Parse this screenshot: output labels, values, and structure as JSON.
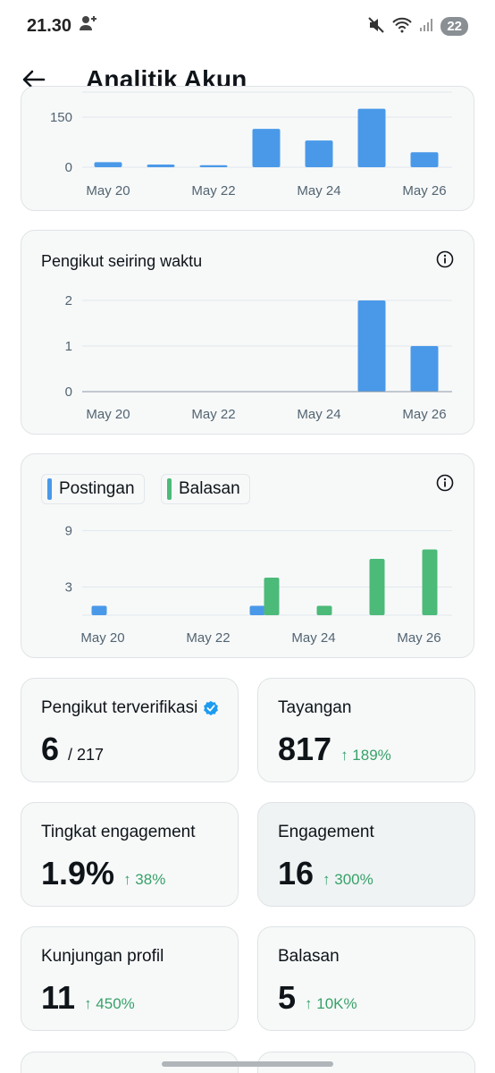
{
  "status_bar": {
    "time": "21.30",
    "battery": "22"
  },
  "header": {
    "title": "Analitik Akun"
  },
  "chart_top": {
    "chart_data": {
      "type": "bar",
      "categories": [
        "May 20",
        "May 21",
        "May 22",
        "May 23",
        "May 24",
        "May 25",
        "May 26"
      ],
      "values": [
        15,
        8,
        6,
        115,
        80,
        175,
        45
      ],
      "yticks": [
        "0",
        "150"
      ],
      "xticks": [
        "May 20",
        "May 22",
        "May 24",
        "May 26"
      ],
      "color": "#4a99e9"
    }
  },
  "chart_followers": {
    "title": "Pengikut seiring waktu",
    "chart_data": {
      "type": "bar",
      "categories": [
        "May 20",
        "May 21",
        "May 22",
        "May 23",
        "May 24",
        "May 25",
        "May 26"
      ],
      "values": [
        0,
        0,
        0,
        0,
        0,
        2,
        1
      ],
      "yticks": [
        "0",
        "1",
        "2"
      ],
      "xticks": [
        "May 20",
        "May 22",
        "May 24",
        "May 26"
      ],
      "color": "#4a99e9"
    }
  },
  "chart_posts": {
    "legend": {
      "posts": "Postingan",
      "replies": "Balasan"
    },
    "chart_data": {
      "type": "bar",
      "categories": [
        "May 20",
        "May 21",
        "May 22",
        "May 23",
        "May 24",
        "May 25",
        "May 26"
      ],
      "series": [
        {
          "name": "Postingan",
          "values": [
            1,
            0,
            0,
            1,
            0,
            0,
            0
          ],
          "color": "#4a99e9"
        },
        {
          "name": "Balasan",
          "values": [
            0,
            0,
            0,
            4,
            1,
            6,
            7
          ],
          "color": "#4cba79"
        }
      ],
      "yticks": [
        "3",
        "9"
      ],
      "xticks": [
        "May 20",
        "May 22",
        "May 24",
        "May 26"
      ]
    }
  },
  "stats": {
    "verified_followers": {
      "label": "Pengikut terverifikasi",
      "value": "6",
      "total": "/ 217"
    },
    "impressions": {
      "label": "Tayangan",
      "value": "817",
      "change": "↑ 189%"
    },
    "engagement_rate": {
      "label": "Tingkat engagement",
      "value": "1.9%",
      "change": "↑ 38%"
    },
    "engagements": {
      "label": "Engagement",
      "value": "16",
      "change": "↑ 300%"
    },
    "profile_visits": {
      "label": "Kunjungan profil",
      "value": "11",
      "change": "↑ 450%"
    },
    "replies": {
      "label": "Balasan",
      "value": "5",
      "change": "↑ 10K%"
    }
  }
}
